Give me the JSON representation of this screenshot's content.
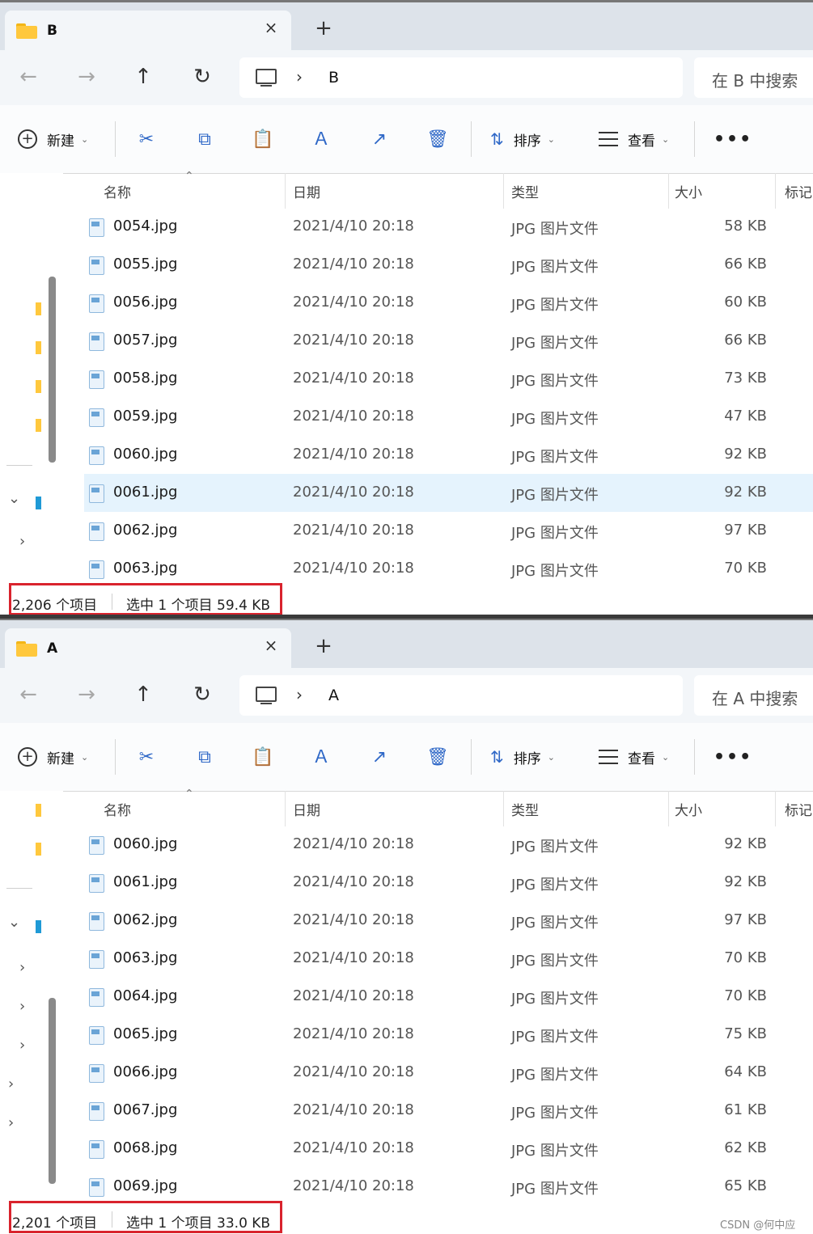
{
  "windows": [
    {
      "tab_title": "B",
      "address": "B",
      "search_placeholder": "在 B 中搜索",
      "status_items": "2,206 个项目",
      "status_selection": "选中 1 个项目  59.4 KB",
      "rows": [
        {
          "name": "0054.jpg",
          "date": "2021/4/10 20:18",
          "type": "JPG 图片文件",
          "size": "58 KB"
        },
        {
          "name": "0055.jpg",
          "date": "2021/4/10 20:18",
          "type": "JPG 图片文件",
          "size": "66 KB"
        },
        {
          "name": "0056.jpg",
          "date": "2021/4/10 20:18",
          "type": "JPG 图片文件",
          "size": "60 KB"
        },
        {
          "name": "0057.jpg",
          "date": "2021/4/10 20:18",
          "type": "JPG 图片文件",
          "size": "66 KB"
        },
        {
          "name": "0058.jpg",
          "date": "2021/4/10 20:18",
          "type": "JPG 图片文件",
          "size": "73 KB"
        },
        {
          "name": "0059.jpg",
          "date": "2021/4/10 20:18",
          "type": "JPG 图片文件",
          "size": "47 KB"
        },
        {
          "name": "0060.jpg",
          "date": "2021/4/10 20:18",
          "type": "JPG 图片文件",
          "size": "92 KB"
        },
        {
          "name": "0061.jpg",
          "date": "2021/4/10 20:18",
          "type": "JPG 图片文件",
          "size": "92 KB"
        },
        {
          "name": "0062.jpg",
          "date": "2021/4/10 20:18",
          "type": "JPG 图片文件",
          "size": "97 KB"
        },
        {
          "name": "0063.jpg",
          "date": "2021/4/10 20:18",
          "type": "JPG 图片文件",
          "size": "70 KB"
        }
      ]
    },
    {
      "tab_title": "A",
      "address": "A",
      "search_placeholder": "在 A 中搜索",
      "status_items": "2,201 个项目",
      "status_selection": "选中 1 个项目  33.0 KB",
      "rows": [
        {
          "name": "0060.jpg",
          "date": "2021/4/10 20:18",
          "type": "JPG 图片文件",
          "size": "92 KB"
        },
        {
          "name": "0061.jpg",
          "date": "2021/4/10 20:18",
          "type": "JPG 图片文件",
          "size": "92 KB"
        },
        {
          "name": "0062.jpg",
          "date": "2021/4/10 20:18",
          "type": "JPG 图片文件",
          "size": "97 KB"
        },
        {
          "name": "0063.jpg",
          "date": "2021/4/10 20:18",
          "type": "JPG 图片文件",
          "size": "70 KB"
        },
        {
          "name": "0064.jpg",
          "date": "2021/4/10 20:18",
          "type": "JPG 图片文件",
          "size": "70 KB"
        },
        {
          "name": "0065.jpg",
          "date": "2021/4/10 20:18",
          "type": "JPG 图片文件",
          "size": "75 KB"
        },
        {
          "name": "0066.jpg",
          "date": "2021/4/10 20:18",
          "type": "JPG 图片文件",
          "size": "64 KB"
        },
        {
          "name": "0067.jpg",
          "date": "2021/4/10 20:18",
          "type": "JPG 图片文件",
          "size": "61 KB"
        },
        {
          "name": "0068.jpg",
          "date": "2021/4/10 20:18",
          "type": "JPG 图片文件",
          "size": "62 KB"
        },
        {
          "name": "0069.jpg",
          "date": "2021/4/10 20:18",
          "type": "JPG 图片文件",
          "size": "65 KB"
        }
      ]
    }
  ],
  "toolbar": {
    "new_label": "新建",
    "sort_label": "排序",
    "view_label": "查看",
    "more_label": "•••"
  },
  "columns": {
    "name": "名称",
    "date": "日期",
    "type": "类型",
    "size": "大小",
    "tags": "标记"
  },
  "icons": {
    "close": "×",
    "new_tab": "+",
    "back": "←",
    "forward": "→",
    "up": "↑",
    "refresh": "↻",
    "chevron": "›",
    "cut": "✂",
    "copy": "⧉",
    "paste": "📋",
    "rename": "Ａ",
    "share": "↗",
    "delete": "🗑",
    "sort": "⇅",
    "caret_down": "⌄",
    "sort_indicator": "⌃"
  },
  "colors": {
    "selection": "#e5f3fd",
    "highlight_box": "#d9232d",
    "accent": "#2f68c7",
    "folder": "#ffc83d"
  },
  "selected_row_index_window_b": 7,
  "watermark": "CSDN @何中应"
}
